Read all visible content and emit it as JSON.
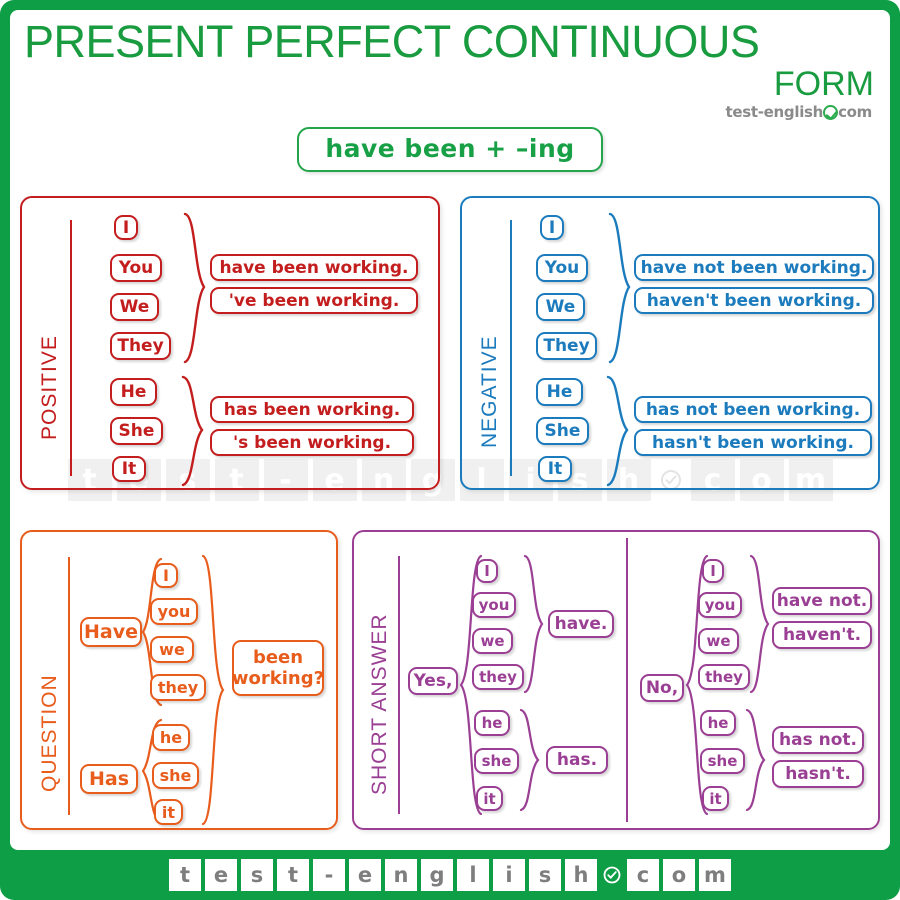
{
  "header": {
    "title_line1": "PRESENT PERFECT CONTINUOUS",
    "title_line2": "FORM",
    "logo_text_left": "test-english",
    "logo_text_right": "com",
    "logo_icon": "green-check-circle-icon"
  },
  "formula": {
    "text": "have been + –ing"
  },
  "watermark": {
    "letters": [
      "t",
      "e",
      "s",
      "t",
      "-",
      "e",
      "n",
      "g",
      "l",
      "i",
      "s",
      "h",
      "c",
      "o",
      "m"
    ],
    "check_after_index": 11
  },
  "colors": {
    "green": "#0e9e45",
    "title_green": "#199b3f",
    "red": "#c31d1d",
    "blue": "#1b7bbd",
    "orange": "#e85c1c",
    "purple": "#9a3f93",
    "gray": "#8a8a8a"
  },
  "panels": {
    "positive": {
      "label": "POSITIVE",
      "group1": {
        "pronouns": [
          "I",
          "You",
          "We",
          "They"
        ],
        "forms": [
          "have been working.",
          "'ve been working."
        ]
      },
      "group2": {
        "pronouns": [
          "He",
          "She",
          "It"
        ],
        "forms": [
          "has been working.",
          "'s been working."
        ]
      }
    },
    "negative": {
      "label": "NEGATIVE",
      "group1": {
        "pronouns": [
          "I",
          "You",
          "We",
          "They"
        ],
        "forms": [
          "have not been working.",
          "haven't been working."
        ]
      },
      "group2": {
        "pronouns": [
          "He",
          "She",
          "It"
        ],
        "forms": [
          "has not been working.",
          "hasn't been working."
        ]
      }
    },
    "question": {
      "label": "QUESTION",
      "aux1": "Have",
      "group1": {
        "pronouns": [
          "I",
          "you",
          "we",
          "they"
        ]
      },
      "aux2": "Has",
      "group2": {
        "pronouns": [
          "he",
          "she",
          "it"
        ]
      },
      "tail": "been\nworking?"
    },
    "short_answer": {
      "label": "SHORT ANSWER",
      "yes": {
        "lead": "Yes,",
        "group1": {
          "pronouns": [
            "I",
            "you",
            "we",
            "they"
          ],
          "forms": [
            "have."
          ]
        },
        "group2": {
          "pronouns": [
            "he",
            "she",
            "it"
          ],
          "forms": [
            "has."
          ]
        }
      },
      "no": {
        "lead": "No,",
        "group1": {
          "pronouns": [
            "I",
            "you",
            "we",
            "they"
          ],
          "forms": [
            "have not.",
            "haven't."
          ]
        },
        "group2": {
          "pronouns": [
            "he",
            "she",
            "it"
          ],
          "forms": [
            "has not.",
            "hasn't."
          ]
        }
      }
    }
  },
  "footer": {
    "letters": [
      "t",
      "e",
      "s",
      "t",
      "-",
      "e",
      "n",
      "g",
      "l",
      "i",
      "s",
      "h",
      "c",
      "o",
      "m"
    ],
    "check_after_index": 11
  }
}
